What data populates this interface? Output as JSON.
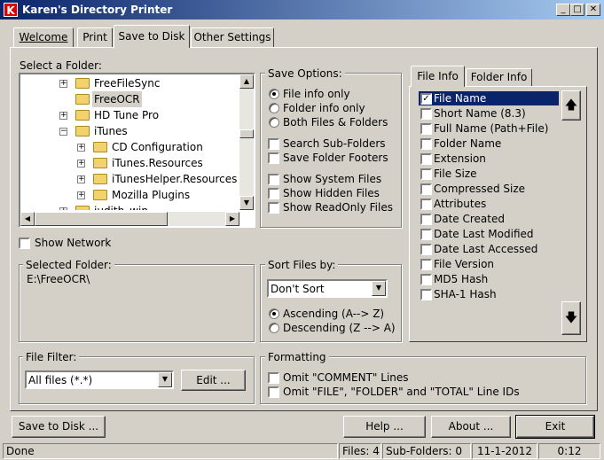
{
  "window": {
    "title": "Karen's Directory Printer",
    "icon_letter": "K"
  },
  "tabs": [
    {
      "label": "Welcome"
    },
    {
      "label": "Print"
    },
    {
      "label": "Save to Disk"
    },
    {
      "label": "Other Settings"
    }
  ],
  "folder_panel": {
    "label": "Select a Folder:",
    "tree": [
      {
        "name": "FreeFileSync",
        "expandable": true,
        "level": 0
      },
      {
        "name": "FreeOCR",
        "expandable": false,
        "level": 0,
        "selected": true
      },
      {
        "name": "HD Tune Pro",
        "expandable": true,
        "level": 0
      },
      {
        "name": "iTunes",
        "expandable": true,
        "expanded": true,
        "level": 0
      },
      {
        "name": "CD Configuration",
        "expandable": true,
        "level": 1
      },
      {
        "name": "iTunes.Resources",
        "expandable": true,
        "level": 1
      },
      {
        "name": "iTunesHelper.Resources",
        "expandable": true,
        "level": 1
      },
      {
        "name": "Mozilla Plugins",
        "expandable": true,
        "level": 1
      },
      {
        "name": "judith_win",
        "expandable": true,
        "level": 0
      }
    ],
    "show_network": "Show Network"
  },
  "selected_folder": {
    "label": "Selected Folder:",
    "path": "E:\\FreeOCR\\"
  },
  "save_options": {
    "label": "Save Options:",
    "radios": [
      "File info only",
      "Folder info only",
      "Both Files & Folders"
    ],
    "checks1": [
      "Search Sub-Folders",
      "Save Folder Footers"
    ],
    "checks2": [
      "Show System Files",
      "Show Hidden Files",
      "Show ReadOnly Files"
    ]
  },
  "sort_files": {
    "label": "Sort Files by:",
    "selected": "Don't Sort",
    "ascending": "Ascending (A--> Z)",
    "descending": "Descending (Z --> A)"
  },
  "file_filter": {
    "label": "File Filter:",
    "selected": "All files (*.*)",
    "edit": "Edit ..."
  },
  "formatting": {
    "label": "Formatting",
    "omit_comment": "Omit \"COMMENT\" Lines",
    "omit_ids": "Omit \"FILE\", \"FOLDER\" and \"TOTAL\" Line IDs"
  },
  "info_tabs": {
    "file_info": "File Info",
    "folder_info": "Folder Info"
  },
  "file_fields": [
    {
      "label": "File Name",
      "checked": true
    },
    {
      "label": "Short Name (8.3)"
    },
    {
      "label": "Full Name (Path+File)"
    },
    {
      "label": "Folder Name"
    },
    {
      "label": "Extension"
    },
    {
      "label": "File Size"
    },
    {
      "label": "Compressed Size"
    },
    {
      "label": "Attributes"
    },
    {
      "label": "Date Created"
    },
    {
      "label": "Date Last Modified"
    },
    {
      "label": "Date Last Accessed"
    },
    {
      "label": "File Version"
    },
    {
      "label": "MD5 Hash"
    },
    {
      "label": "SHA-1 Hash"
    }
  ],
  "buttons": {
    "save": "Save to Disk ...",
    "help": "Help ...",
    "about": "About ...",
    "exit": "Exit"
  },
  "status": {
    "state": "Done",
    "files": "Files: 4",
    "subfolders": "Sub-Folders: 0",
    "date": "11-1-2012",
    "time": "0:12"
  }
}
